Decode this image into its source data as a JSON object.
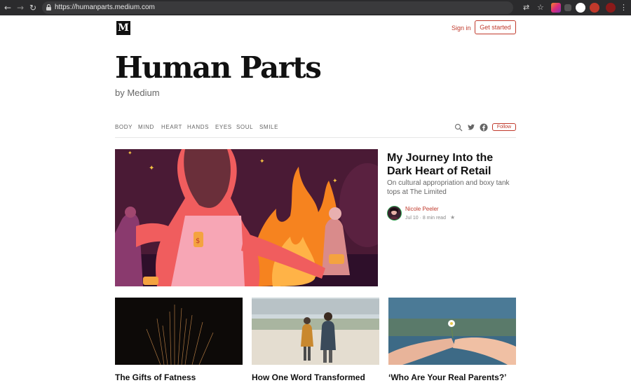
{
  "browser": {
    "url": "https://humanparts.medium.com"
  },
  "header": {
    "logo": "M",
    "sign_in": "Sign in",
    "get_started": "Get started"
  },
  "publication": {
    "title": "Human Parts",
    "subtitle": "by Medium"
  },
  "nav": {
    "items": [
      "BODY",
      "MIND",
      "HEART",
      "HANDS",
      "EYES",
      "SOUL",
      "SMILE"
    ],
    "follow": "Follow"
  },
  "featured": {
    "title": "My Journey Into the Dark Heart of Retail",
    "description": "On cultural appropriation and boxy tank tops at The Limited",
    "author": "Nicole Peeler",
    "meta": "Jul 10 · 8 min read",
    "star": "★"
  },
  "cards": [
    {
      "title": "The Gifts of Fatness"
    },
    {
      "title": "How One Word Transformed"
    },
    {
      "title": "‘Who Are Your Real Parents?’"
    }
  ],
  "colors": {
    "accent": "#c0392b",
    "chrome": "#2b2b2d"
  }
}
